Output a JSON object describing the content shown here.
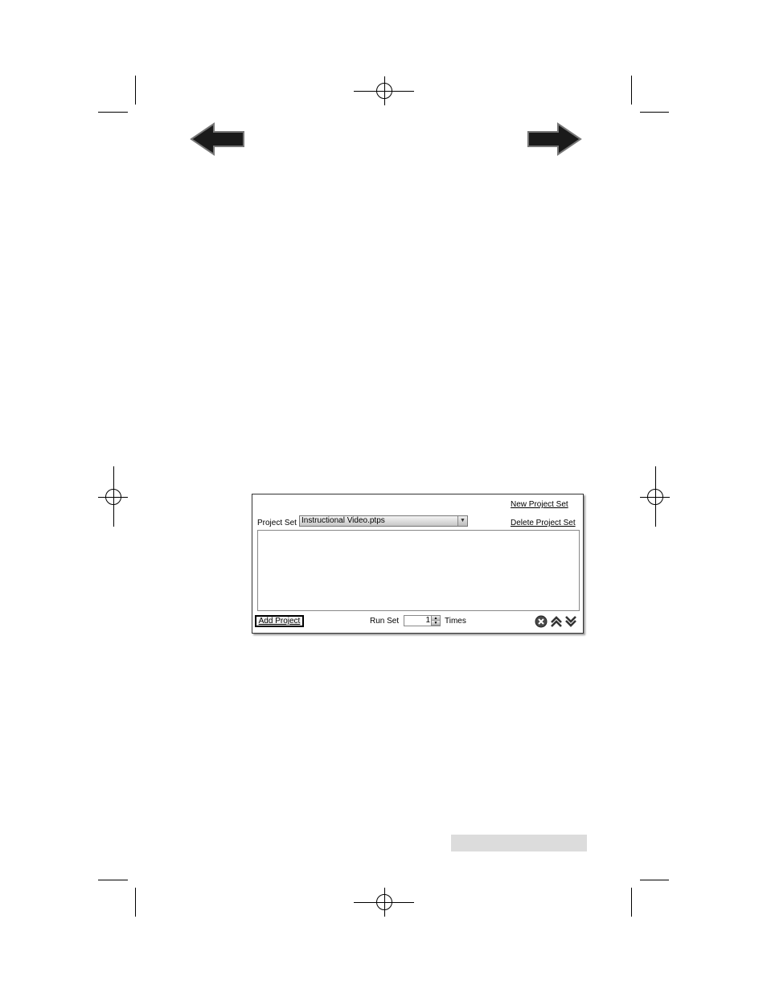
{
  "navigation": {
    "back_icon": "back-arrow-icon",
    "forward_icon": "forward-arrow-icon"
  },
  "dialog": {
    "new_project_set_label": "New Project Set",
    "delete_project_set_label": "Delete Project Set",
    "project_set_label": "Project Set",
    "project_set_selected": "Instructional Video.ptps",
    "add_project_label": "Add Project",
    "run_set_label": "Run Set",
    "run_set_value": "1",
    "times_label": "Times",
    "icons": {
      "remove": "remove-icon",
      "move_up": "move-up-icon",
      "move_down": "move-down-icon"
    }
  }
}
